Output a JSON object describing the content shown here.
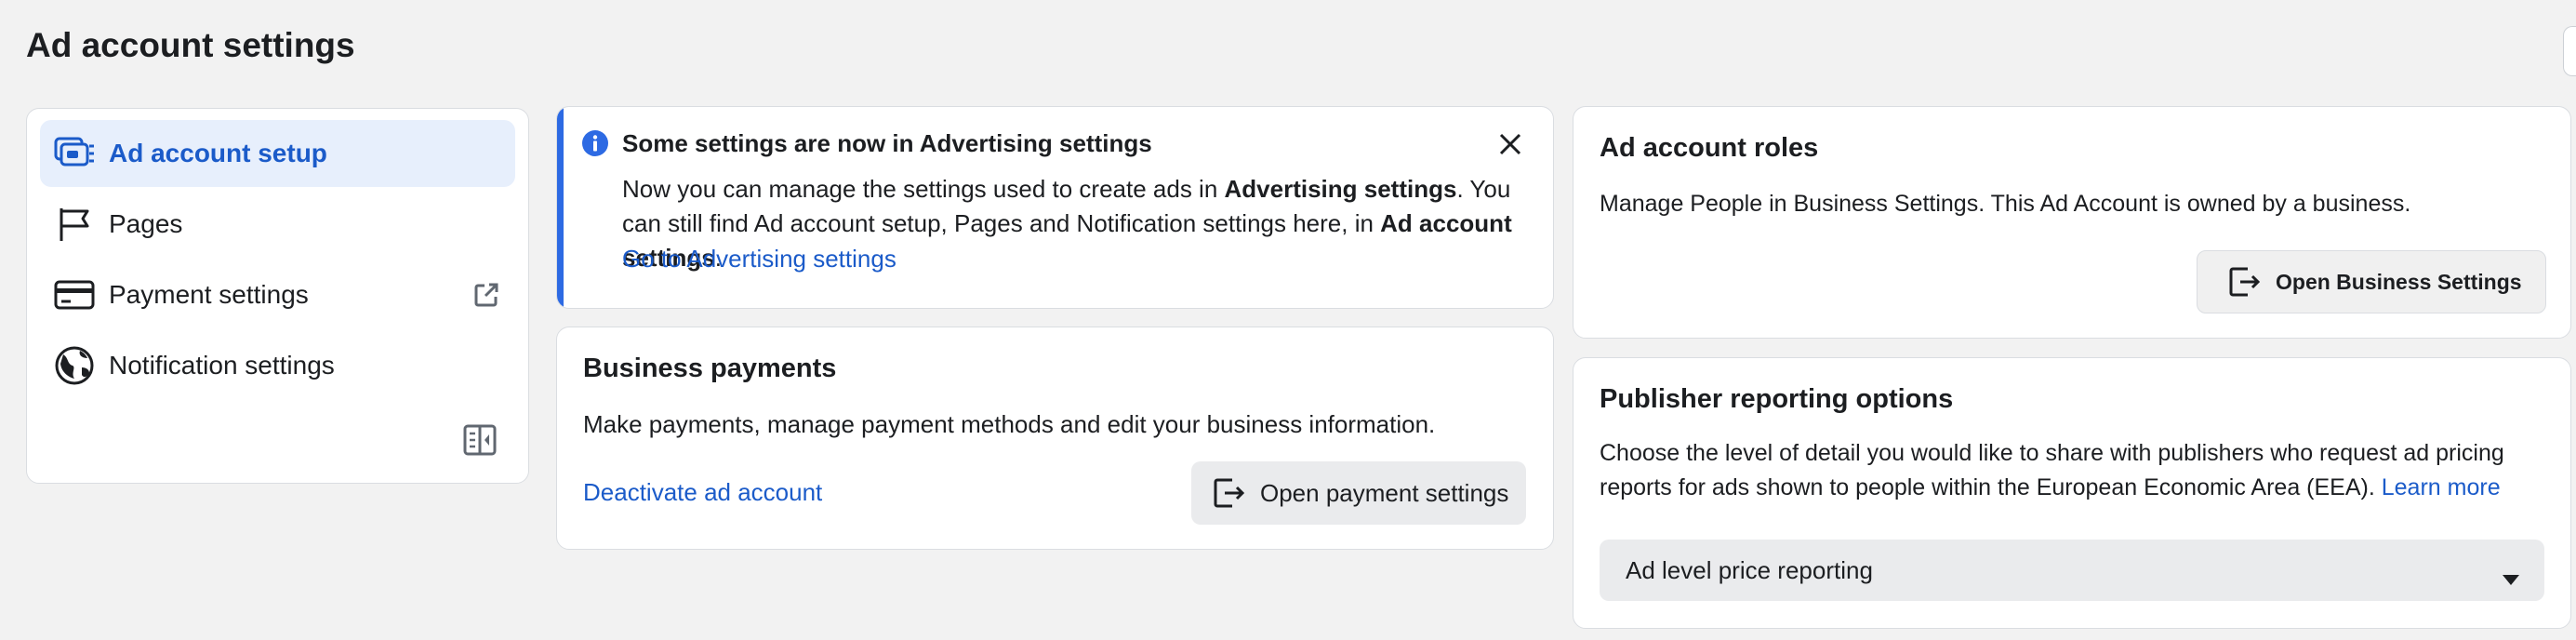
{
  "page_title": "Ad account settings",
  "nav": {
    "items": [
      {
        "label": "Ad account setup",
        "icon": "ad-account-setup-icon",
        "active": true
      },
      {
        "label": "Pages",
        "icon": "flag-icon"
      },
      {
        "label": "Payment settings",
        "icon": "credit-card-icon",
        "external": "external-link-icon"
      },
      {
        "label": "Notification settings",
        "icon": "globe-icon"
      }
    ],
    "collapse_icon": "collapse-panel-icon"
  },
  "notice": {
    "title": "Some settings are now in Advertising settings",
    "body_1": "Now you can manage the settings used to create ads in ",
    "body_bold_1": "Advertising settings",
    "body_2": ". You can still find Ad account setup, Pages and Notification settings here, in ",
    "body_bold_2": "Ad account settings",
    "body_3": ".",
    "link": "Go to Advertising settings",
    "accent": "#2d6ae3"
  },
  "business_payments": {
    "title": "Business payments",
    "text": "Make payments, manage payment methods and edit your business information.",
    "deactivate_link": "Deactivate ad account",
    "button": "Open payment settings"
  },
  "roles": {
    "title": "Ad account roles",
    "text": "Manage People in Business Settings. This Ad Account is owned by a business.",
    "button": "Open Business Settings"
  },
  "publisher": {
    "title": "Publisher reporting options",
    "text": "Choose the level of detail you would like to share with publishers who request ad pricing reports for ads shown to people within the European Economic Area (EEA). ",
    "learn_more": "Learn more",
    "select_value": "Ad level price reporting"
  },
  "colors": {
    "link": "#1b5bc9",
    "active_bg": "#e7effc"
  }
}
